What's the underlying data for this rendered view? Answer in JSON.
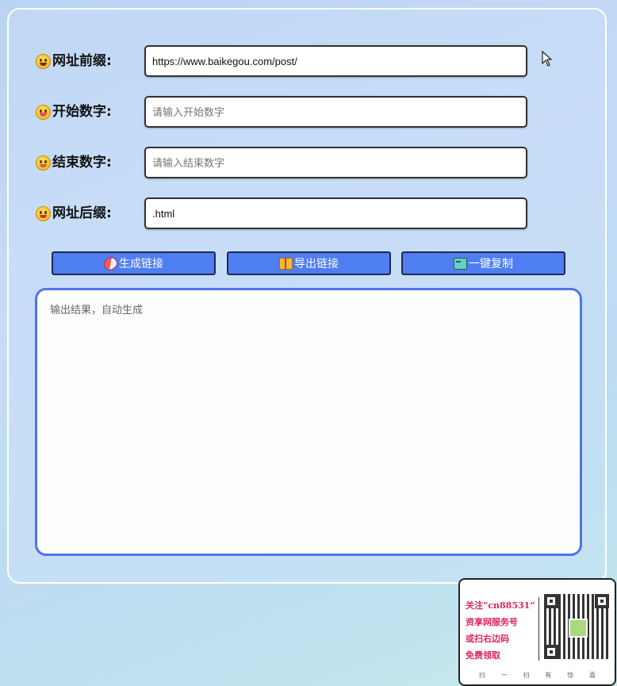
{
  "form": {
    "rows": [
      {
        "label": "网址前缀:",
        "value": "https://www.baikegou.com/post/",
        "placeholder": "",
        "icon": "grinning-face-icon"
      },
      {
        "label": "开始数字:",
        "value": "",
        "placeholder": "请输入开始数字",
        "icon": "tongue-face-icon"
      },
      {
        "label": "结束数字:",
        "value": "",
        "placeholder": "请输入结束数字",
        "icon": "yum-face-icon"
      },
      {
        "label": "网址后缀:",
        "value": ".html",
        "placeholder": "",
        "icon": "heart-face-icon"
      }
    ]
  },
  "buttons": {
    "generate": {
      "label": "生成链接",
      "icon": "pill-icon"
    },
    "export": {
      "label": "导出链接",
      "icon": "gift-icon"
    },
    "copy": {
      "label": "一键复制",
      "icon": "id-card-icon"
    }
  },
  "output": {
    "placeholder": "输出结果，自动生成",
    "value": ""
  },
  "qr_card": {
    "lines": [
      "关注“cn88531”",
      "资享网服务号",
      "或扫右边码",
      "免费领取"
    ],
    "footer": [
      "扫",
      "一",
      "扫",
      "有",
      "惊",
      "喜"
    ]
  },
  "colors": {
    "accent": "#4f7ef3",
    "output_border": "#4f74e6",
    "promo_text": "#e0245e"
  }
}
